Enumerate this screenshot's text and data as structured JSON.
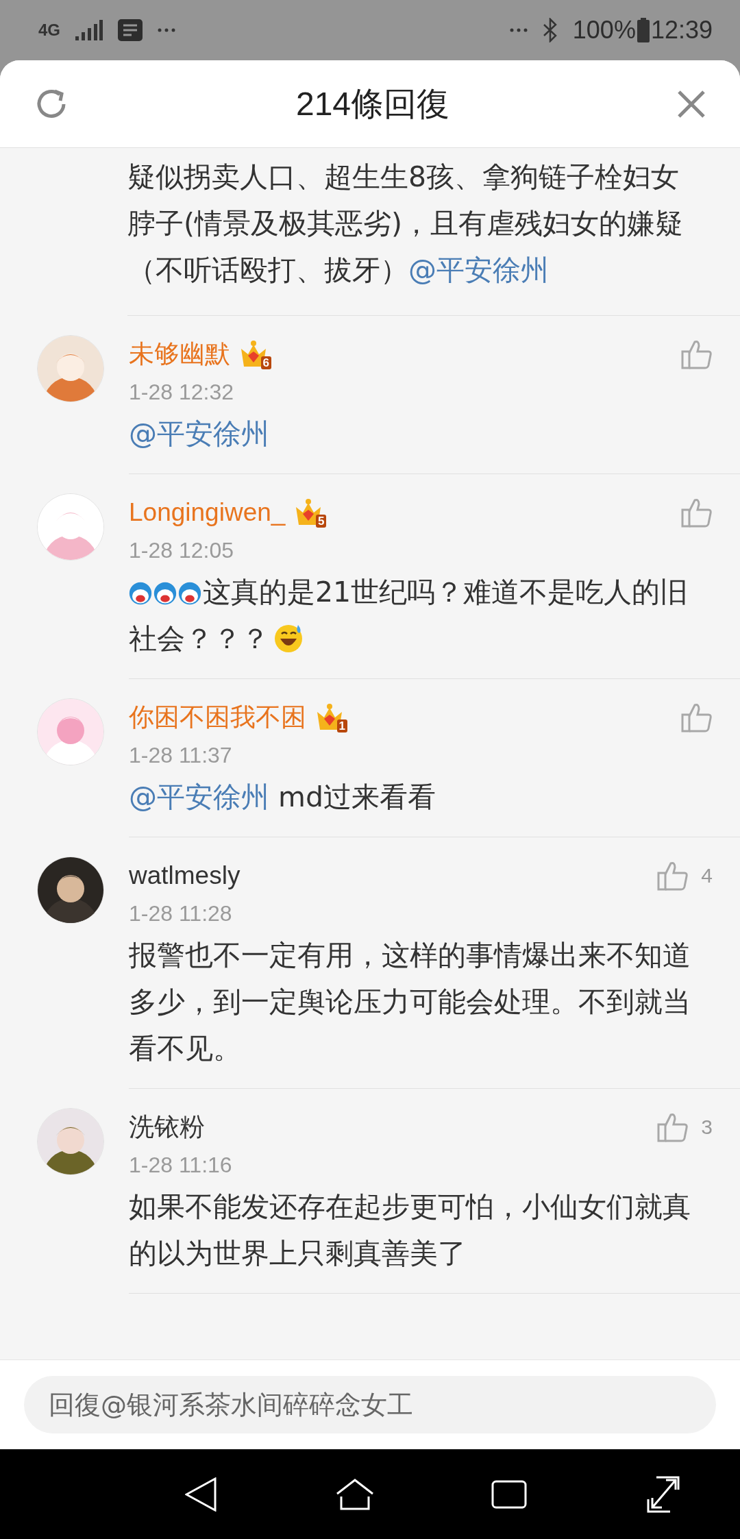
{
  "status_bar": {
    "network": "4G",
    "battery": "100%",
    "time": "12:39"
  },
  "header": {
    "title": "214條回復"
  },
  "comments": [
    {
      "body": [
        {
          "kind": "text",
          "text": "疑似拐卖人口、超生生8孩、拿狗链子栓妇女脖子(情景及极其恶劣)，且有虐残妇女的嫌疑（不听话殴打、拔牙）"
        },
        {
          "kind": "mention",
          "text": "@平安徐州"
        }
      ]
    },
    {
      "user": "未够幽默",
      "badge": "6",
      "time": "1-28 12:32",
      "body": [
        {
          "kind": "mention",
          "text": "@平安徐州"
        }
      ]
    },
    {
      "user": "Longingiwen_",
      "badge": "5",
      "time": "1-28 12:05",
      "body": [
        {
          "kind": "sticker"
        },
        {
          "kind": "sticker"
        },
        {
          "kind": "sticker"
        },
        {
          "kind": "text",
          "text": "这真的是21世纪吗？难道不是吃人的旧社会？？？"
        },
        {
          "kind": "emoji"
        }
      ]
    },
    {
      "user": "你困不困我不困",
      "badge": "1",
      "time": "1-28 11:37",
      "body": [
        {
          "kind": "mention",
          "text": "@平安徐州"
        },
        {
          "kind": "text",
          "text": " md过来看看"
        }
      ]
    },
    {
      "user": "watlmesly",
      "time": "1-28 11:28",
      "likes": "4",
      "body": [
        {
          "kind": "text",
          "text": "报警也不一定有用，这样的事情爆出来不知道多少，到一定舆论压力可能会处理。不到就当看不见。"
        }
      ]
    },
    {
      "user": "洗铱粉",
      "time": "1-28 11:16",
      "likes": "3",
      "body": [
        {
          "kind": "text",
          "text": "如果不能发还存在起步更可怕，小仙女们就真的以为世界上只剩真善美了"
        }
      ]
    }
  ],
  "reply_field": {
    "placeholder": "回復@银河系茶水间碎碎念女工"
  }
}
